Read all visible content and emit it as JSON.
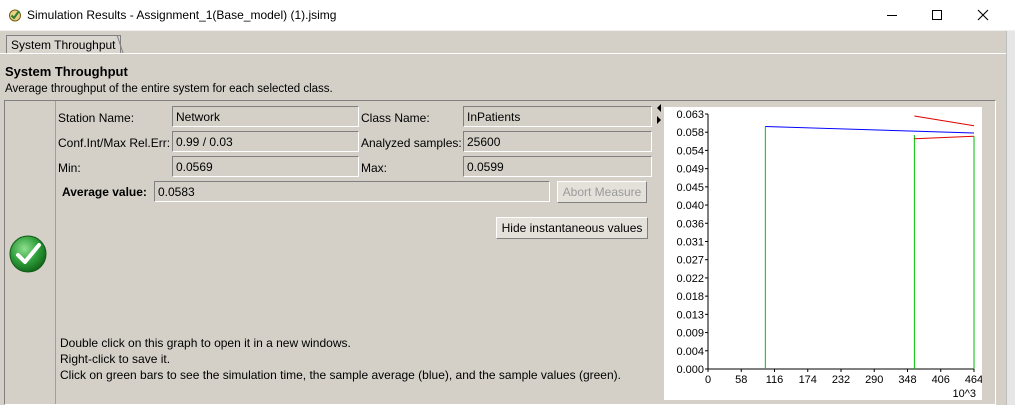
{
  "window": {
    "title": "Simulation Results - Assignment_1(Base_model) (1).jsimg"
  },
  "tab": {
    "label": "System Throughput"
  },
  "section": {
    "title": "System Throughput",
    "description": "Average throughput of the entire system for each selected class."
  },
  "fields": {
    "station_name_label": "Station Name:",
    "station_name": "Network",
    "class_name_label": "Class Name:",
    "class_name": "InPatients",
    "conf_label": "Conf.Int/Max Rel.Err:",
    "conf_value": "0.99 / 0.03",
    "analyzed_label": "Analyzed samples:",
    "analyzed_value": "25600",
    "min_label": "Min:",
    "min_value": "0.0569",
    "max_label": "Max:",
    "max_value": "0.0599",
    "avg_label": "Average value:",
    "avg_value": "0.0583"
  },
  "buttons": {
    "abort": "Abort Measure",
    "hide_instantaneous": "Hide instantaneous values"
  },
  "notes": {
    "line1": "Double click on this graph to open it in a new windows.",
    "line2": "Right-click to save it.",
    "line3": "Click on green bars to see the simulation time, the sample average (blue), and the sample values (green)."
  },
  "status_icon": "checkmark-icon",
  "colors": {
    "mean_line": "#0000ff",
    "interval_lines": "#e00000",
    "sample_bars": "#00c000",
    "check_green": "#2e9d3a"
  },
  "chart_data": {
    "type": "line",
    "y_ticks": [
      "0.063",
      "0.058",
      "0.054",
      "0.049",
      "0.045",
      "0.040",
      "0.036",
      "0.031",
      "0.027",
      "0.022",
      "0.018",
      "0.013",
      "0.009",
      "0.004",
      "0.000"
    ],
    "x_ticks": [
      "0",
      "58",
      "116",
      "174",
      "232",
      "290",
      "348",
      "406",
      "464"
    ],
    "x_unit_label": "10^3",
    "xlim": [
      0,
      464
    ],
    "ylim": [
      0,
      0.063
    ],
    "series": [
      {
        "role": "average",
        "color": "#0000ff",
        "points": [
          [
            100,
            0.0599
          ],
          [
            464,
            0.0583
          ]
        ]
      },
      {
        "role": "upper-bound",
        "color": "#e00000",
        "points": [
          [
            360,
            0.0625
          ],
          [
            464,
            0.0601
          ]
        ]
      },
      {
        "role": "lower-bound",
        "color": "#e00000",
        "points": [
          [
            360,
            0.0569
          ],
          [
            464,
            0.0575
          ]
        ]
      }
    ],
    "samples": [
      {
        "x": 100,
        "y": 0.0599
      },
      {
        "x": 360,
        "y": 0.0578
      },
      {
        "x": 464,
        "y": 0.0575
      }
    ]
  }
}
